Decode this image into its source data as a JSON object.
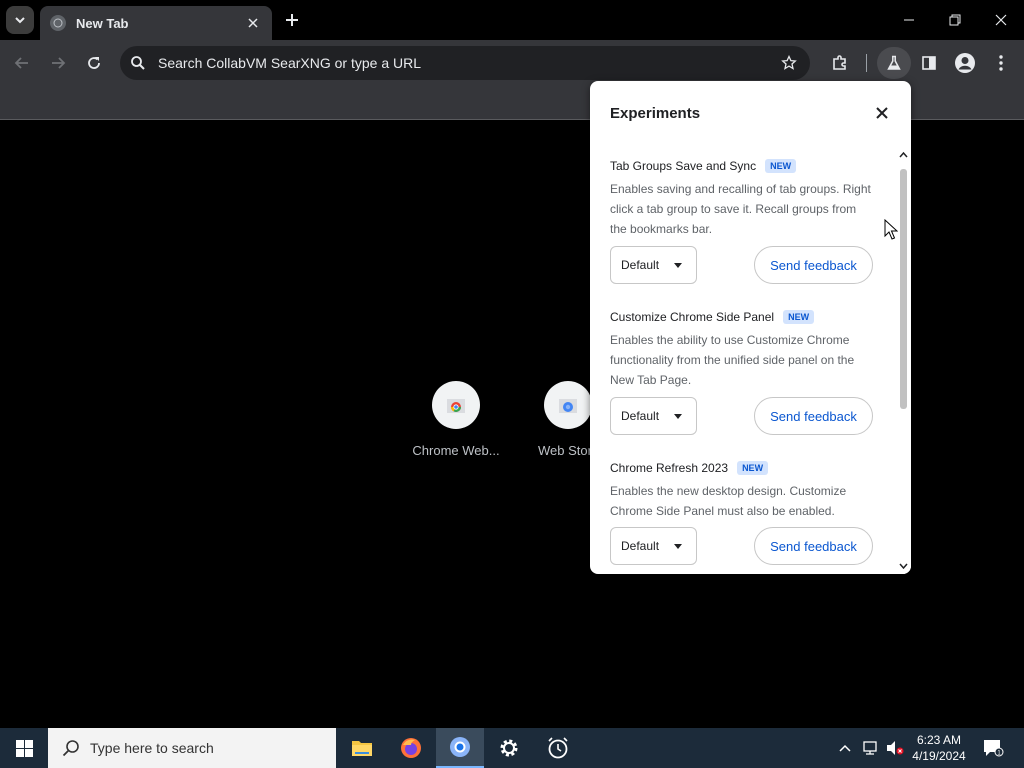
{
  "browser": {
    "tab_title": "New Tab",
    "omnibox_placeholder": "Search CollabVM SearXNG or type a URL"
  },
  "ntp": {
    "shortcuts": [
      {
        "label": "Chrome Web..."
      },
      {
        "label": "Web Store"
      }
    ]
  },
  "experiments": {
    "title": "Experiments",
    "badge": "NEW",
    "items": [
      {
        "name": "Tab Groups Save and Sync",
        "description": "Enables saving and recalling of tab groups. Right click a tab group to save it. Recall groups from the bookmarks bar.",
        "select_value": "Default",
        "feedback_label": "Send feedback"
      },
      {
        "name": "Customize Chrome Side Panel",
        "description": "Enables the ability to use Customize Chrome functionality from the unified side panel on the New Tab Page.",
        "select_value": "Default",
        "feedback_label": "Send feedback"
      },
      {
        "name": "Chrome Refresh 2023",
        "description": "Enables the new desktop design. Customize Chrome Side Panel must also be enabled.",
        "select_value": "Default",
        "feedback_label": "Send feedback"
      }
    ]
  },
  "taskbar": {
    "search_placeholder": "Type here to search",
    "time": "6:23 AM",
    "date": "4/19/2024"
  },
  "colors": {
    "link_blue": "#0b57d0",
    "badge_bg": "#d3e3fd",
    "toolbar_bg": "#35363a",
    "taskbar_bg": "#1c2b3a"
  }
}
